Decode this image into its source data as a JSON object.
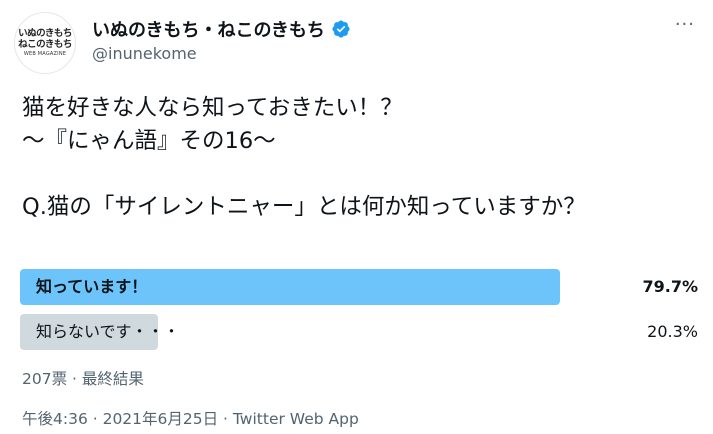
{
  "account": {
    "avatar_line1": "いぬのきもち",
    "avatar_line2": "ねこのきもち",
    "avatar_line3": "WEB MAGAZINE",
    "display_name": "いぬのきもち・ねこのきもち",
    "handle": "@inunekome",
    "verified": true
  },
  "menu": {
    "more_label": "···"
  },
  "tweet": {
    "line1": "猫を好きな人なら知っておきたい！？",
    "line2": "～『にゃん語』その16～",
    "line3": "Q.猫の「サイレントニャー」とは何か知っていますか？"
  },
  "poll": {
    "options": [
      {
        "label": "知っています！",
        "percent_text": "79.7%",
        "percent": 79.7,
        "winner": true
      },
      {
        "label": "知らないです・・・",
        "percent_text": "20.3%",
        "percent": 20.3,
        "winner": false
      }
    ],
    "meta": "207票 · 最終結果"
  },
  "footer": {
    "timestamp": "午後4:36 · 2021年6月25日 · Twitter Web App"
  },
  "colors": {
    "winner_bar": "#6cc4fa",
    "loser_bar": "#cfd9de",
    "verified_badge": "#1d9bf0",
    "secondary_text": "#536471"
  }
}
